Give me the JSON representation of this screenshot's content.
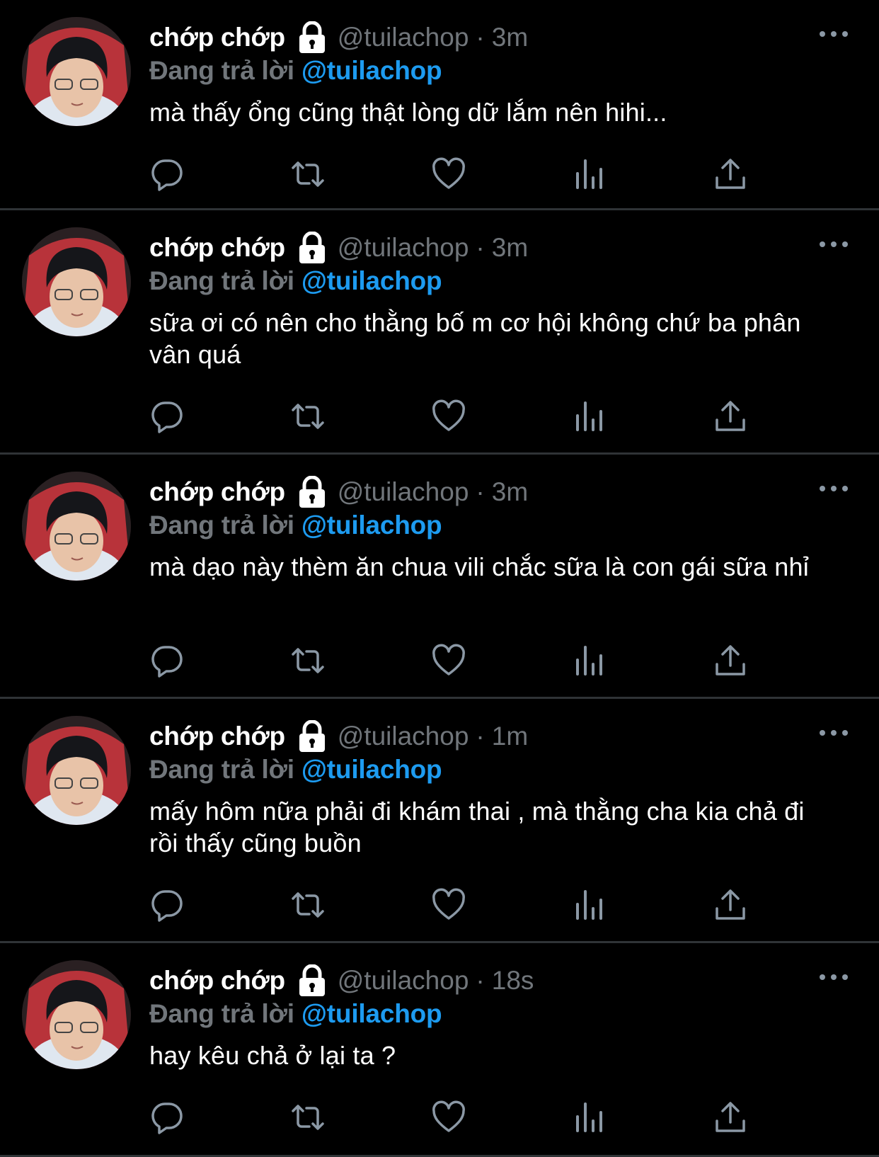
{
  "colors": {
    "background": "#000000",
    "divider": "#2f3336",
    "name": "#ffffff",
    "muted": "#71767b",
    "mention": "#1d9bf0",
    "text": "#ffffff",
    "icon": "#8b98a5"
  },
  "icons": {
    "lock": "lock-icon",
    "more": "more-options-icon",
    "reply": "reply-icon",
    "retweet": "retweet-icon",
    "like": "heart-icon",
    "views": "views-icon",
    "share": "share-icon"
  },
  "tweets": [
    {
      "name": "chớp chớp",
      "handle": "@tuilachop",
      "separator": "·",
      "time": "3m",
      "replying_prefix": "Đang trả lời",
      "replying_to": "@tuilachop",
      "text": "mà thấy ổng cũng thật lòng dữ lắm nên hihi..."
    },
    {
      "name": "chớp chớp",
      "handle": "@tuilachop",
      "separator": "·",
      "time": "3m",
      "replying_prefix": "Đang trả lời",
      "replying_to": "@tuilachop",
      "text": "sữa ơi có nên cho thằng bố m cơ hội không chứ ba phân vân quá"
    },
    {
      "name": "chớp chớp",
      "handle": "@tuilachop",
      "separator": "·",
      "time": "3m",
      "replying_prefix": "Đang trả lời",
      "replying_to": "@tuilachop",
      "text": "mà dạo này thèm ăn chua vili chắc sữa là con gái sữa nhỉ"
    },
    {
      "name": "chớp chớp",
      "handle": "@tuilachop",
      "separator": "·",
      "time": "1m",
      "replying_prefix": "Đang trả lời",
      "replying_to": "@tuilachop",
      "text": "mấy hôm nữa phải đi khám thai , mà thằng cha kia chả đi rồi thấy cũng buồn"
    },
    {
      "name": "chớp chớp",
      "handle": "@tuilachop",
      "separator": "·",
      "time": "18s",
      "replying_prefix": "Đang trả lời",
      "replying_to": "@tuilachop",
      "text": "hay kêu chả ở lại ta ?"
    }
  ]
}
